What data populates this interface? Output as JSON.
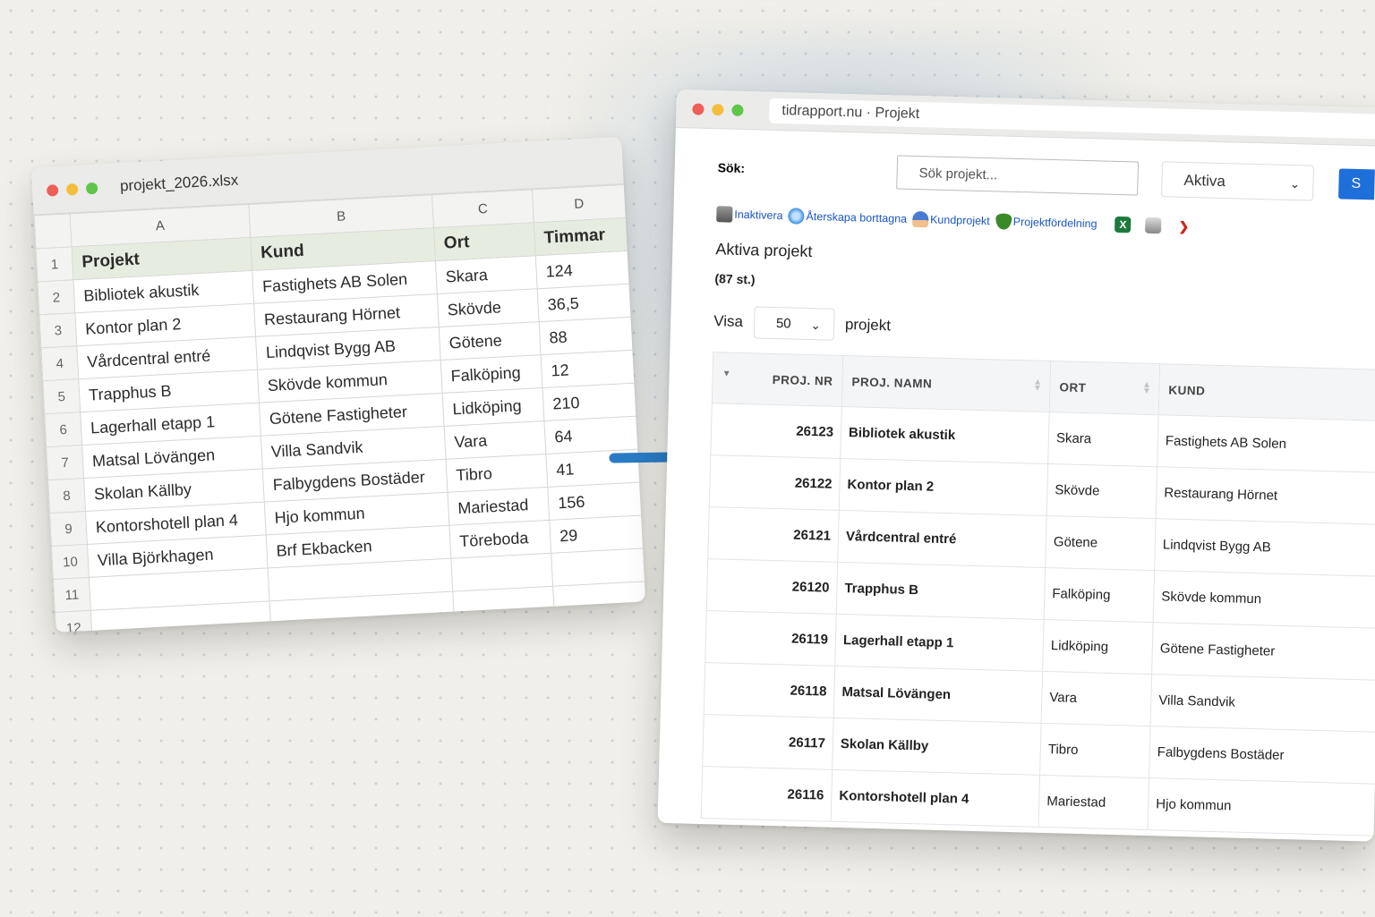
{
  "excel": {
    "title": "projekt_2026.xlsx",
    "columns": [
      "A",
      "B",
      "C",
      "D"
    ],
    "header_row": [
      "Projekt",
      "Kund",
      "Ort",
      "Timmar"
    ],
    "rows": [
      {
        "num": "2",
        "cells": [
          "Bibliotek akustik",
          "Fastighets AB Solen",
          "Skara",
          "124"
        ]
      },
      {
        "num": "3",
        "cells": [
          "Kontor plan 2",
          "Restaurang Hörnet",
          "Skövde",
          "36,5"
        ]
      },
      {
        "num": "4",
        "cells": [
          "Vårdcentral entré",
          "Lindqvist Bygg AB",
          "Götene",
          "88"
        ]
      },
      {
        "num": "5",
        "cells": [
          "Trapphus B",
          "Skövde kommun",
          "Falköping",
          "12"
        ]
      },
      {
        "num": "6",
        "cells": [
          "Lagerhall etapp 1",
          "Götene Fastigheter",
          "Lidköping",
          "210"
        ]
      },
      {
        "num": "7",
        "cells": [
          "Matsal Lövängen",
          "Villa Sandvik",
          "Vara",
          "64"
        ]
      },
      {
        "num": "8",
        "cells": [
          "Skolan Källby",
          "Falbygdens Bostäder",
          "Tibro",
          "41"
        ]
      },
      {
        "num": "9",
        "cells": [
          "Kontorshotell plan 4",
          "Hjo kommun",
          "Mariestad",
          "156"
        ]
      },
      {
        "num": "10",
        "cells": [
          "Villa Björkhagen",
          "Brf Ekbacken",
          "Töreboda",
          "29"
        ]
      },
      {
        "num": "11",
        "cells": [
          "",
          "",
          "",
          ""
        ]
      },
      {
        "num": "12",
        "cells": [
          "",
          "",
          "",
          ""
        ]
      }
    ]
  },
  "browser": {
    "url": "tidrapport.nu · Projekt",
    "search_label": "Sök:",
    "search_placeholder": "Sök projekt...",
    "status_select": "Aktiva",
    "search_button": "S",
    "toolbar": [
      {
        "label": "Inaktivera",
        "icon": "trash-icon"
      },
      {
        "label": "Återskapa borttagna",
        "icon": "refresh-icon"
      },
      {
        "label": "Kundprojekt",
        "icon": "person-icon"
      },
      {
        "label": "Projektfördelning",
        "icon": "shield-icon"
      }
    ],
    "export_icons": [
      "excel-icon",
      "print-icon",
      "pdf-icon"
    ],
    "heading": "Aktiva projekt",
    "count": "(87 st.)",
    "visa_label": "Visa",
    "visa_value": "50",
    "visa_suffix": "projekt",
    "table_headers": [
      "PROJ. NR",
      "PROJ. NAMN",
      "ORT",
      "KUND"
    ],
    "rows": [
      {
        "nr": "26123",
        "namn": "Bibliotek akustik",
        "ort": "Skara",
        "kund": "Fastighets AB Solen"
      },
      {
        "nr": "26122",
        "namn": "Kontor plan 2",
        "ort": "Skövde",
        "kund": "Restaurang Hörnet"
      },
      {
        "nr": "26121",
        "namn": "Vårdcentral entré",
        "ort": "Götene",
        "kund": "Lindqvist Bygg AB"
      },
      {
        "nr": "26120",
        "namn": "Trapphus B",
        "ort": "Falköping",
        "kund": "Skövde kommun"
      },
      {
        "nr": "26119",
        "namn": "Lagerhall etapp 1",
        "ort": "Lidköping",
        "kund": "Götene Fastigheter"
      },
      {
        "nr": "26118",
        "namn": "Matsal Lövängen",
        "ort": "Vara",
        "kund": "Villa Sandvik"
      },
      {
        "nr": "26117",
        "namn": "Skolan Källby",
        "ort": "Tibro",
        "kund": "Falbygdens Bostäder"
      },
      {
        "nr": "26116",
        "namn": "Kontorshotell plan 4",
        "ort": "Mariestad",
        "kund": "Hjo kommun"
      }
    ]
  },
  "colors": {
    "accent": "#2a7ac4",
    "link": "#1b55c9",
    "button": "#1e6fd9",
    "excel_header_fill": "#e6ede0"
  }
}
